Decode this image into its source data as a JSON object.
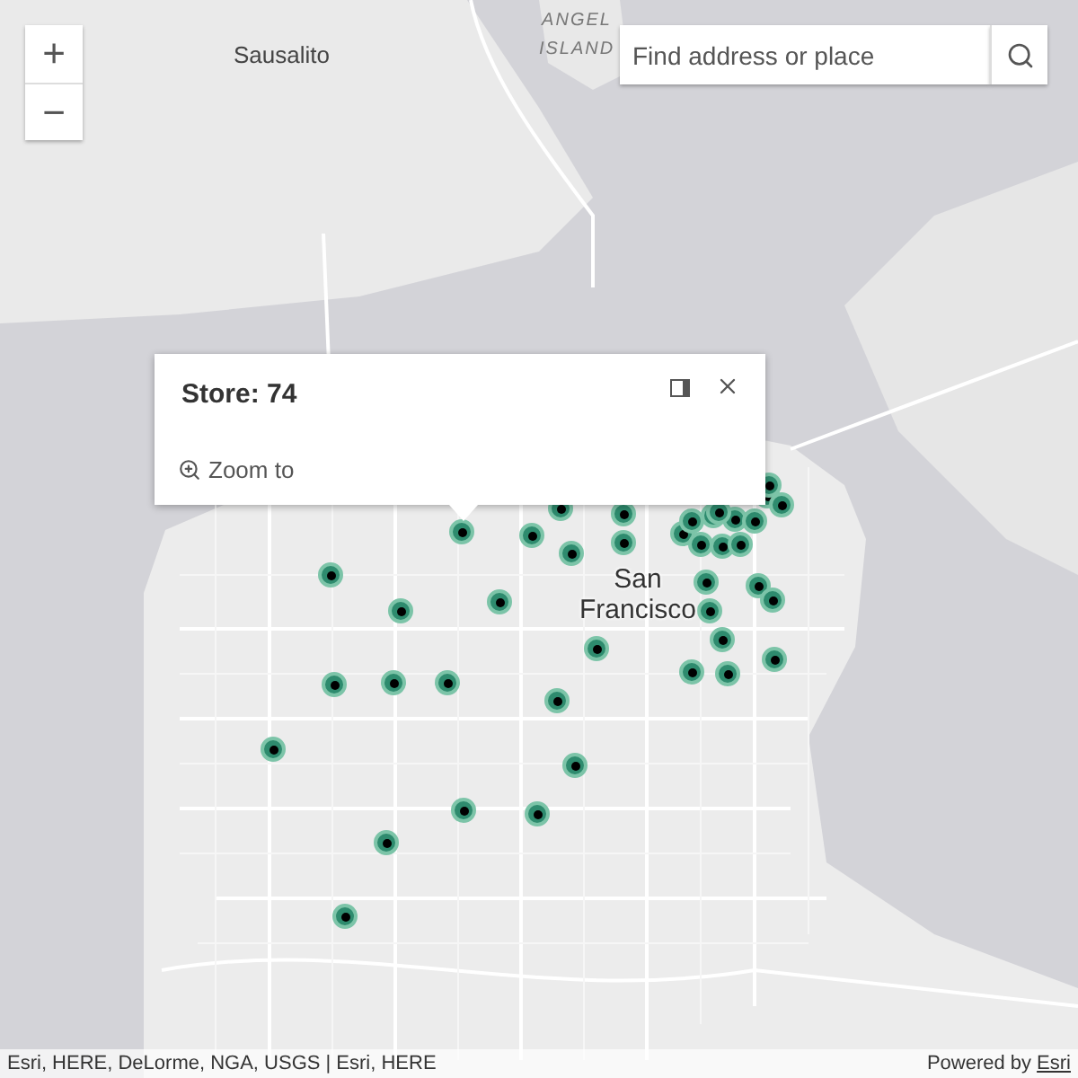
{
  "zoom_controls": [
    {
      "label": "+"
    },
    {
      "label": "−"
    }
  ],
  "search": {
    "placeholder": "Find address or place"
  },
  "map_labels": [
    {
      "text": "Sausalito",
      "kind": "town"
    },
    {
      "text": "ANGEL ISLAND",
      "kind": "island"
    },
    {
      "text": "San Francisco",
      "kind": "city"
    }
  ],
  "popup": {
    "title": "Store: 74",
    "action": "Zoom to"
  },
  "attribution": {
    "sources": "Esri, HERE, DeLorme, NGA, USGS | Esri, HERE",
    "powered_by": "Powered by",
    "link": "Esri"
  }
}
